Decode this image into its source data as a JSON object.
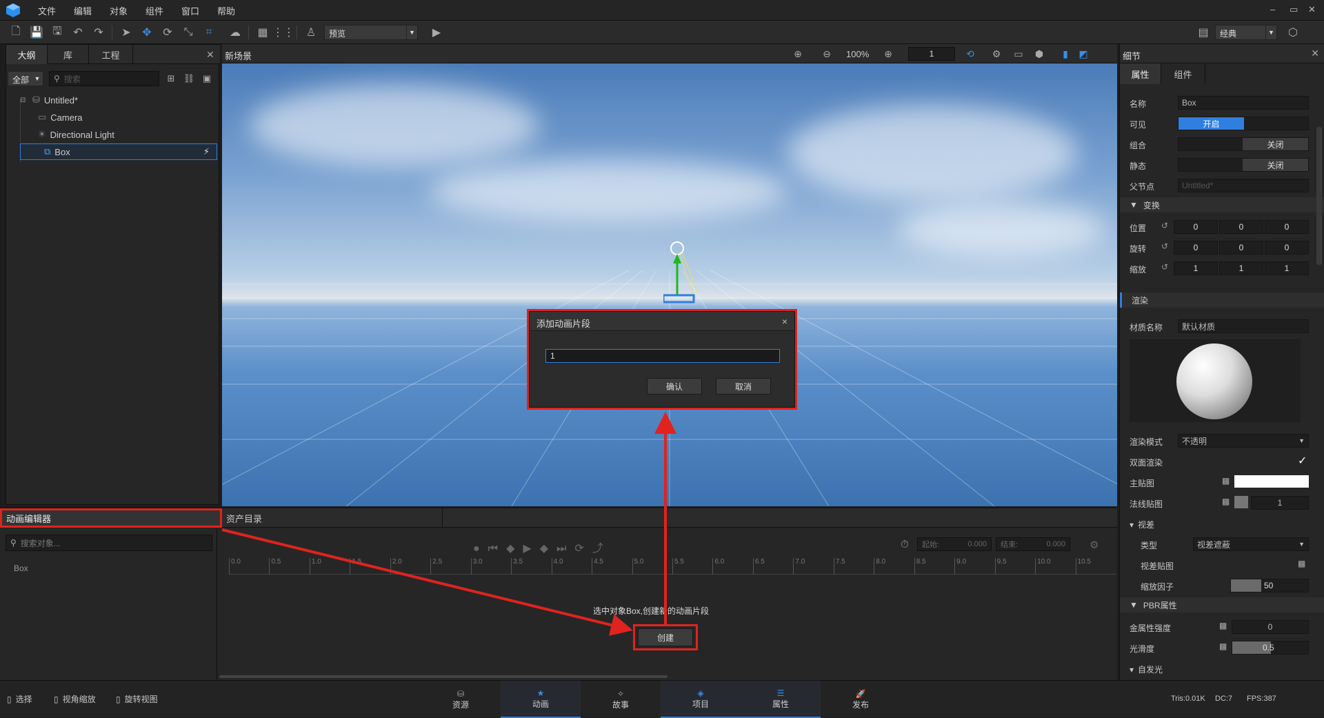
{
  "menubar": {
    "items": [
      "文件",
      "编辑",
      "对象",
      "组件",
      "窗口",
      "帮助"
    ],
    "window_controls": [
      "–",
      "▭",
      "✕"
    ]
  },
  "toolbar": {
    "preview_label": "预览",
    "layout_label": "经典"
  },
  "outliner": {
    "tabs": [
      "大纲",
      "库",
      "工程"
    ],
    "filter_label": "全部",
    "search_placeholder": "搜索",
    "tree": [
      {
        "label": "Untitled*",
        "icon": "scene-icon"
      },
      {
        "label": "Camera",
        "icon": "camera-icon"
      },
      {
        "label": "Directional Light",
        "icon": "light-icon"
      },
      {
        "label": "Box",
        "icon": "box-icon"
      }
    ]
  },
  "viewport": {
    "title": "新场景",
    "zoom": "100%",
    "camera_index": "1"
  },
  "dialog": {
    "title": "添加动画片段",
    "input_value": "1",
    "confirm_label": "确认",
    "cancel_label": "取消",
    "close_glyph": "×"
  },
  "anim_panel": {
    "tabs": [
      "动画编辑器",
      "资产目录"
    ],
    "search_placeholder": "搜索对象...",
    "object_label": "Box",
    "start_label": "起始:",
    "start_value": "0.000",
    "end_label": "结束:",
    "end_value": "0.000",
    "ruler_ticks": [
      "0.0",
      "0.5",
      "1.0",
      "1.5",
      "2.0",
      "2.5",
      "3.0",
      "3.5",
      "4.0",
      "4.5",
      "5.0",
      "5.5",
      "6.0",
      "6.5",
      "7.0",
      "7.5",
      "8.0",
      "8.5",
      "9.0",
      "9.5",
      "10.0",
      "10.5"
    ],
    "hint_text": "选中对象Box,创建新的动画片段",
    "create_label": "创建"
  },
  "details": {
    "title": "细节",
    "tabs": [
      "属性",
      "组件"
    ],
    "name_label": "名称",
    "name_value": "Box",
    "visible_label": "可见",
    "visible_value": "开启",
    "group_label": "组合",
    "group_value": "关闭",
    "static_label": "静态",
    "static_value": "关闭",
    "parent_label": "父节点",
    "parent_value": "Untitled*",
    "transform_section": "变换",
    "position_label": "位置",
    "position": [
      "0",
      "0",
      "0"
    ],
    "rotation_label": "旋转",
    "rotation": [
      "0",
      "0",
      "0"
    ],
    "scale_label": "缩放",
    "scale": [
      "1",
      "1",
      "1"
    ],
    "render_section": "渲染",
    "material_label": "材质名称",
    "material_value": "默认材质",
    "render_mode_label": "渲染模式",
    "render_mode_value": "不透明",
    "double_side_label": "双面渲染",
    "main_tex_label": "主贴图",
    "normal_tex_label": "法线贴图",
    "normal_value": "1",
    "parallax_label": "视差",
    "type_label": "类型",
    "type_value": "视差遮蔽",
    "parallax_tex_label": "视差贴图",
    "scale_factor_label": "缩放因子",
    "scale_factor_value": "50",
    "pbr_section": "PBR属性",
    "metal_label": "金属性强度",
    "metal_value": "0",
    "smooth_label": "光滑度",
    "smooth_value": "0.5",
    "emissive_label": "自发光"
  },
  "statusbar": {
    "tools": [
      "选择",
      "视角缩放",
      "旋转视图"
    ],
    "tabs": [
      "资源",
      "动画",
      "故事",
      "项目",
      "属性",
      "发布"
    ],
    "tris": "Tris:0.01K",
    "dc": "DC:7",
    "fps": "FPS:387"
  },
  "colors": {
    "accent": "#2f7fe0",
    "highlight": "#e0231e",
    "panel": "#262626"
  }
}
